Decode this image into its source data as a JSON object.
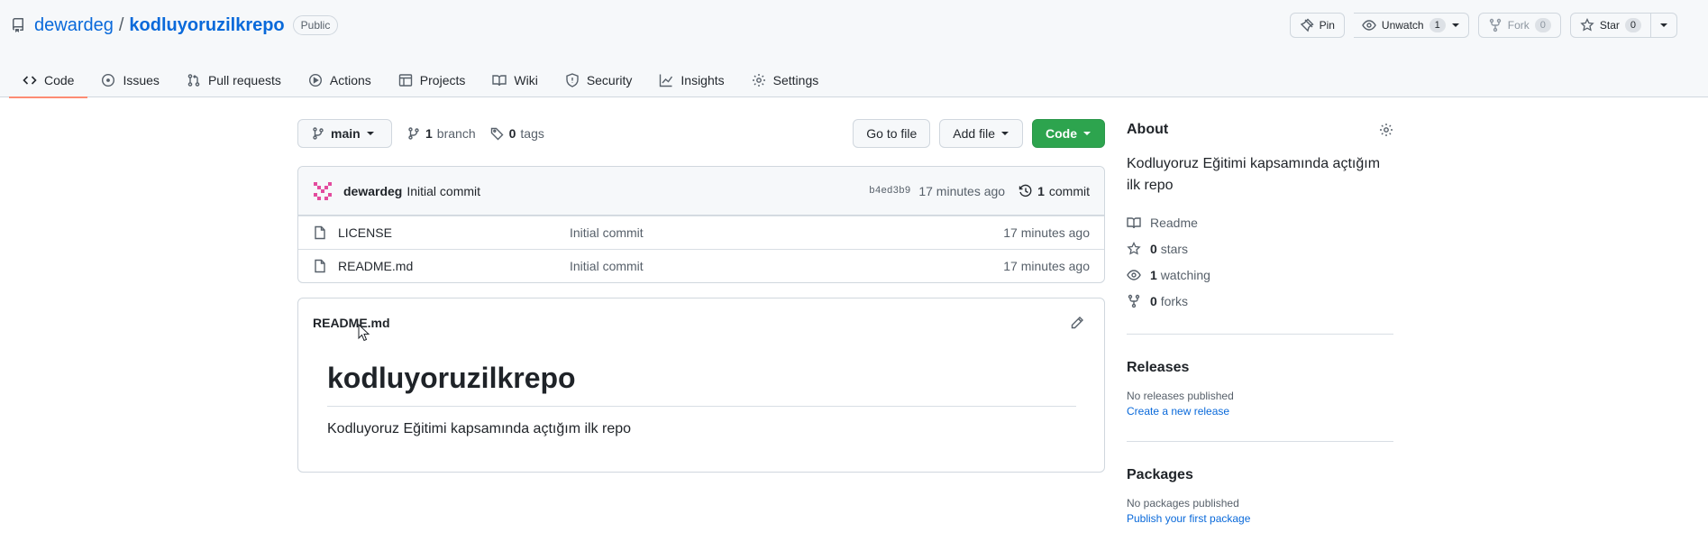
{
  "header": {
    "owner": "dewardeg",
    "separator": "/",
    "repo": "kodluyoruzilkrepo",
    "visibility": "Public",
    "actions": {
      "pin": "Pin",
      "unwatch": "Unwatch",
      "watch_count": "1",
      "fork": "Fork",
      "fork_count": "0",
      "star": "Star",
      "star_count": "0"
    }
  },
  "tabs": [
    {
      "label": "Code",
      "icon": "code-icon"
    },
    {
      "label": "Issues",
      "icon": "issue-icon"
    },
    {
      "label": "Pull requests",
      "icon": "pull-request-icon"
    },
    {
      "label": "Actions",
      "icon": "play-icon"
    },
    {
      "label": "Projects",
      "icon": "table-icon"
    },
    {
      "label": "Wiki",
      "icon": "book-icon"
    },
    {
      "label": "Security",
      "icon": "shield-icon"
    },
    {
      "label": "Insights",
      "icon": "graph-icon"
    },
    {
      "label": "Settings",
      "icon": "gear-icon"
    }
  ],
  "file_nav": {
    "branch": "main",
    "branch_count": "1",
    "branch_label": "branch",
    "tag_count": "0",
    "tag_label": "tags",
    "go_to_file": "Go to file",
    "add_file": "Add file",
    "code": "Code"
  },
  "latest_commit": {
    "author": "dewardeg",
    "message": "Initial commit",
    "sha": "b4ed3b9",
    "age": "17 minutes ago",
    "count": "1",
    "count_label": "commit"
  },
  "files": [
    {
      "name": "LICENSE",
      "message": "Initial commit",
      "age": "17 minutes ago"
    },
    {
      "name": "README.md",
      "message": "Initial commit",
      "age": "17 minutes ago"
    }
  ],
  "readme": {
    "filename": "README.md",
    "heading": "kodluyoruzilkrepo",
    "body": "Kodluyoruz Eğitimi kapsamında açtığım ilk repo"
  },
  "about": {
    "title": "About",
    "description": "Kodluyoruz Eğitimi kapsamında açtığım ilk repo",
    "readme": "Readme",
    "stars_count": "0",
    "stars_label": "stars",
    "watching_count": "1",
    "watching_label": "watching",
    "forks_count": "0",
    "forks_label": "forks"
  },
  "releases": {
    "title": "Releases",
    "note": "No releases published",
    "link": "Create a new release"
  },
  "packages": {
    "title": "Packages",
    "note": "No packages published",
    "link": "Publish your first package"
  },
  "colors": {
    "accent_link": "#0969da",
    "primary_button": "#2da44e",
    "active_tab_underline": "#fd8c73"
  }
}
